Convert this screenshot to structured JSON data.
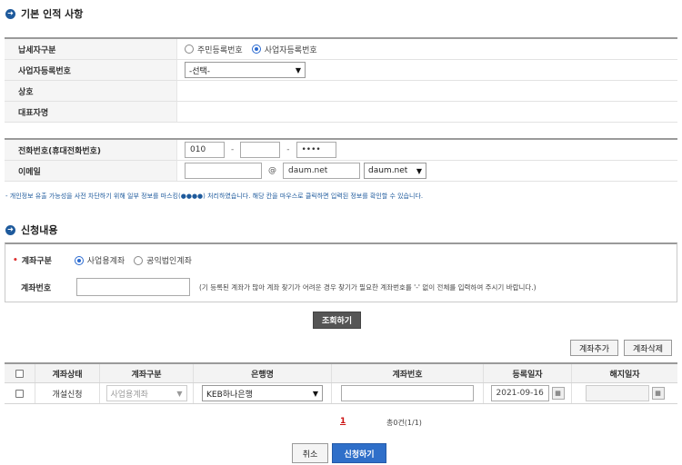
{
  "section1": {
    "title": "기본 인적 사항"
  },
  "fields": {
    "taxpayer_type": {
      "label": "납세자구분",
      "option1": "주민등록번호",
      "option2": "사업자등록번호",
      "selected": 2
    },
    "biz_number": {
      "label": "사업자등록번호",
      "selected_value": "-선택-"
    },
    "company": {
      "label": "상호",
      "value": ""
    },
    "ceo": {
      "label": "대표자명",
      "value": ""
    },
    "phone": {
      "label": "전화번호(휴대전화번호)",
      "part1": "010",
      "part2": "",
      "part3": "••••",
      "separator": "-"
    },
    "email": {
      "label": "이메일",
      "local": "",
      "at": "@",
      "domain": "daum.net",
      "domain_select": "daum.net"
    }
  },
  "privacy_note": "- 개인정보 유출 가능성을 사전 차단하기 위해 일부 정보를 마스킹(●●●●) 처리하였습니다. 해당 칸을 마우스로 클릭하면 입력된 정보를 확인할 수 있습니다.",
  "section2": {
    "title": "신청내용"
  },
  "apply": {
    "account_type_label": "계좌구분",
    "required_mark": "•",
    "option1": "사업용계좌",
    "option2": "공익법인계좌",
    "selected": 1,
    "account_no_label": "계좌번호",
    "account_no_value": "",
    "account_no_help": "(기 등록된 계좌가 많아 계좌 찾기가 어려운 경우 찾기가 필요한 계좌번호를 '-' 없이 전체를 입력하여 주시기 바랍니다.)"
  },
  "buttons": {
    "search": "조회하기",
    "add_account": "계좌추가",
    "delete_account": "계좌삭제",
    "cancel": "취소",
    "submit": "신청하기"
  },
  "grid": {
    "headers": [
      "",
      "계좌상태",
      "계좌구분",
      "은행명",
      "계좌번호",
      "등록일자",
      "해지일자"
    ],
    "rows": [
      {
        "status": "개설신청",
        "type": "사업용계좌",
        "bank": "KEB하나은행",
        "account": "",
        "reg_date": "2021-09-16",
        "end_date": ""
      }
    ]
  },
  "pagination": {
    "current": "1",
    "summary": "총0건(1/1)"
  },
  "colors": {
    "accent": "#1e5a9c",
    "submit": "#2f6fc9",
    "search_btn": "#555555"
  }
}
